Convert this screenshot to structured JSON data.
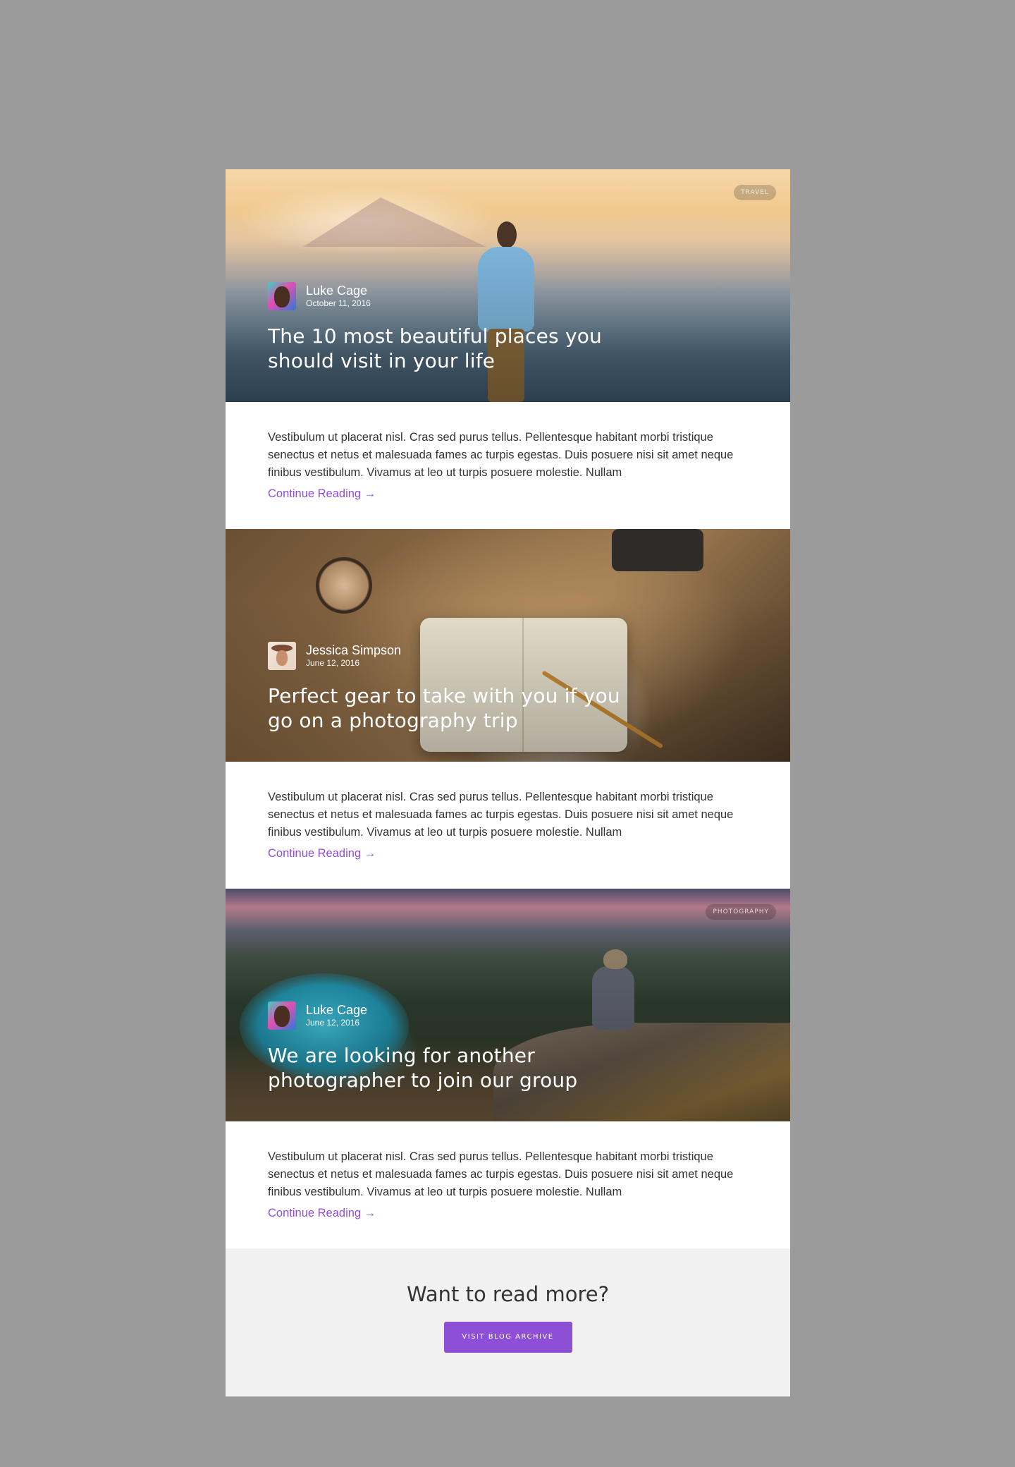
{
  "posts": [
    {
      "badge": "TRAVEL",
      "author": "Luke Cage",
      "date": "October 11, 2016",
      "title": "The 10 most beautiful places you should visit in your life",
      "excerpt": "Vestibulum ut placerat nisl. Cras sed purus tellus. Pellentesque habitant morbi tristique senectus et netus et malesuada fames ac turpis egestas. Duis posuere nisi sit amet neque finibus vestibulum. Vivamus at leo ut turpis posuere molestie. Nullam",
      "continue_label": "Continue Reading →"
    },
    {
      "badge": "",
      "author": "Jessica Simpson",
      "date": "June 12, 2016",
      "title": "Perfect gear to take with you if you go on a photography trip",
      "excerpt": "Vestibulum ut placerat nisl. Cras sed purus tellus. Pellentesque habitant morbi tristique senectus et netus et malesuada fames ac turpis egestas. Duis posuere nisi sit amet neque finibus vestibulum. Vivamus at leo ut turpis posuere molestie. Nullam",
      "continue_label": "Continue Reading →"
    },
    {
      "badge": "PHOTOGRAPHY",
      "author": "Luke Cage",
      "date": "June 12, 2016",
      "title": "We are looking for another photographer to join our group",
      "excerpt": "Vestibulum ut placerat nisl. Cras sed purus tellus. Pellentesque habitant morbi tristique senectus et netus et malesuada fames ac turpis egestas. Duis posuere nisi sit amet neque finibus vestibulum. Vivamus at leo ut turpis posuere molestie. Nullam",
      "continue_label": "Continue Reading →"
    }
  ],
  "more": {
    "title": "Want to read more?",
    "button_label": "VISIT BLOG ARCHIVE"
  },
  "colors": {
    "accent": "#8c4fd6",
    "page_background": "#9b9b9b",
    "footer_background": "#f1f1f1"
  }
}
